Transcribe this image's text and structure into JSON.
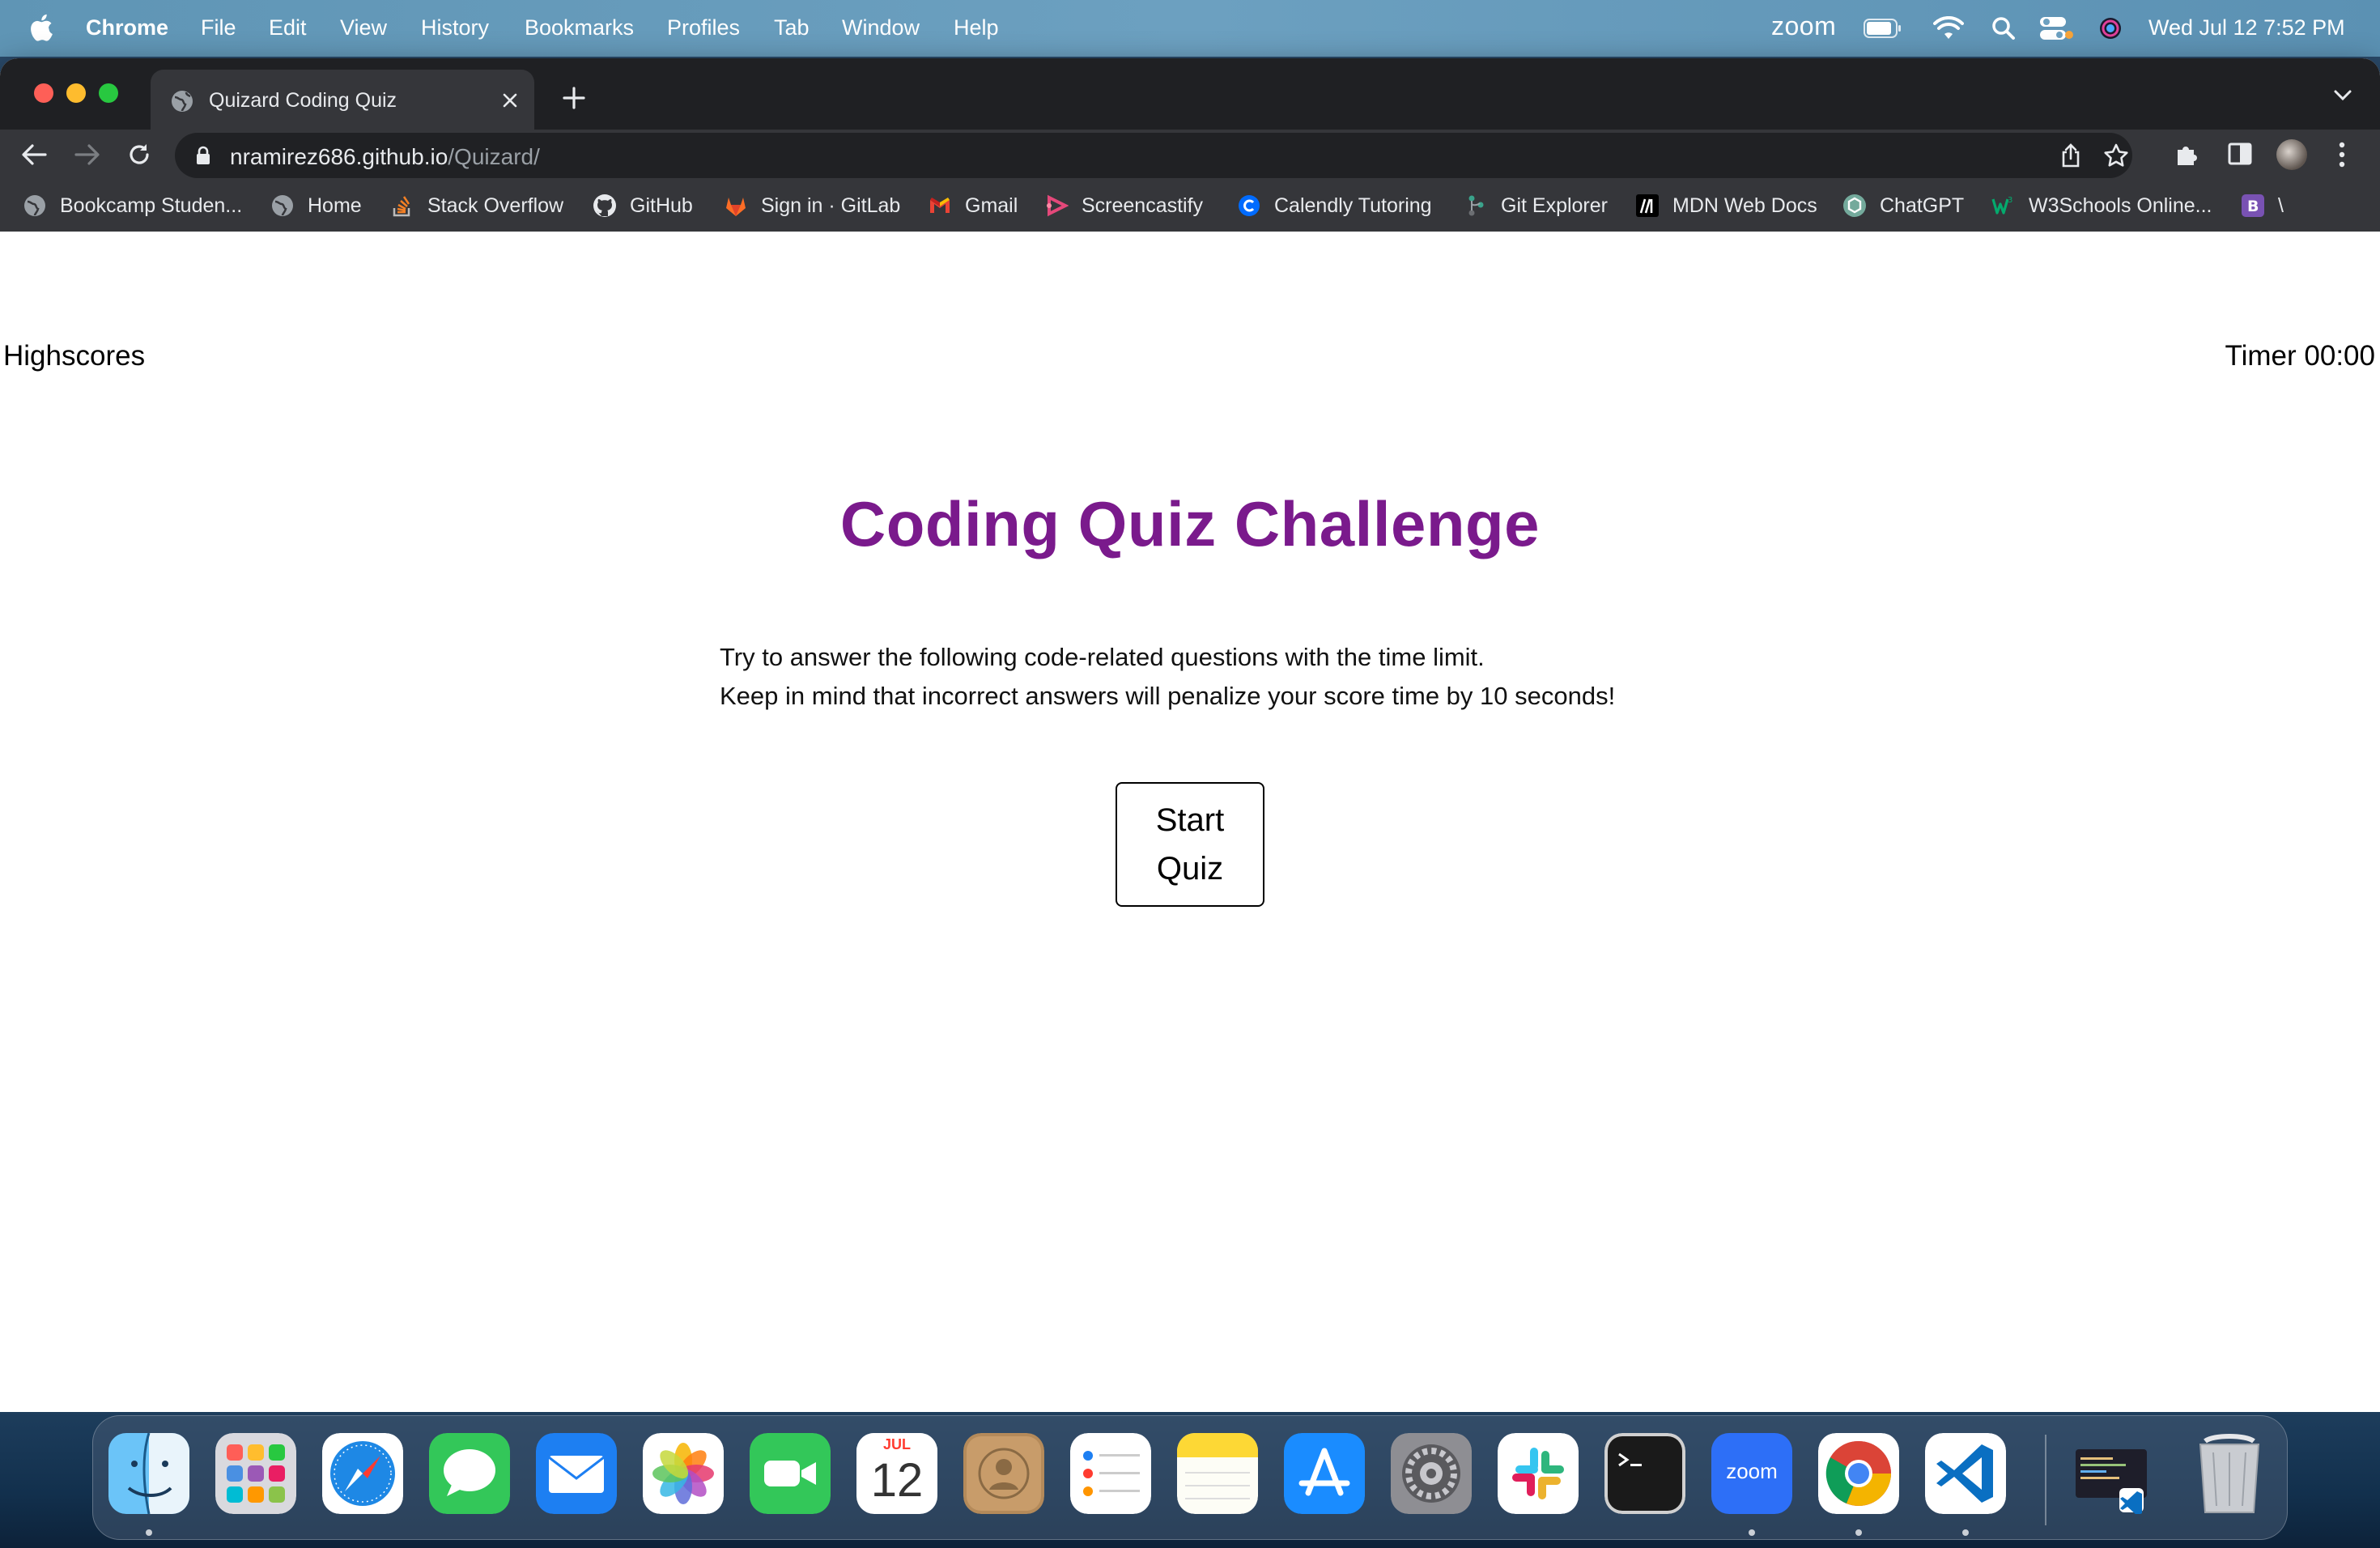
{
  "menubar": {
    "app_name": "Chrome",
    "items": [
      "File",
      "Edit",
      "View",
      "History",
      "Bookmarks",
      "Profiles",
      "Tab",
      "Window",
      "Help"
    ],
    "zoom_label": "zoom",
    "datetime": "Wed Jul 12  7:52 PM"
  },
  "browser": {
    "tab_title": "Quizard Coding Quiz",
    "url_host": "nramirez686.github.io",
    "url_path": "/Quizard/",
    "bookmarks": [
      "Bookcamp Studen...",
      "Home",
      "Stack Overflow",
      "GitHub",
      "Sign in · GitLab",
      "Gmail",
      "Screencastify",
      "Calendly Tutoring",
      "Git Explorer",
      "MDN Web Docs",
      "ChatGPT",
      "W3Schools Online...",
      "\\"
    ]
  },
  "page": {
    "highscores": "Highscores",
    "timer": "Timer 00:00",
    "heading": "Coding Quiz Challenge",
    "desc_line1": "Try to answer the following code-related questions with the time limit.",
    "desc_line2": "Keep in mind that incorrect answers will penalize your score time by 10 seconds!",
    "start_button": "Start Quiz",
    "heading_color": "#7a1a8c"
  },
  "dock": {
    "calendar_month": "JUL",
    "calendar_day": "12",
    "zoom_label": "zoom",
    "apps": [
      "finder-icon",
      "launchpad-icon",
      "safari-icon",
      "messages-icon",
      "mail-icon",
      "photos-icon",
      "facetime-icon",
      "calendar-icon",
      "contacts-icon",
      "reminders-icon",
      "notes-icon",
      "app-store-icon",
      "system-settings-icon",
      "slack-icon",
      "terminal-icon",
      "zoom-icon",
      "chrome-icon",
      "vscode-icon",
      "downloads-stack-icon",
      "trash-icon"
    ]
  }
}
